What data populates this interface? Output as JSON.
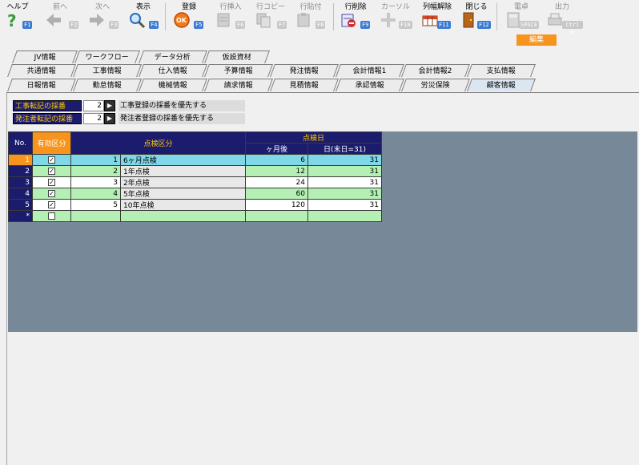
{
  "toolbar": {
    "buttons": [
      {
        "label": "ヘルプ",
        "key": "F1",
        "icon": "help-icon",
        "enabled": true
      },
      {
        "label": "前へ",
        "key": "F2",
        "icon": "arrow-left-icon",
        "enabled": false
      },
      {
        "label": "次へ",
        "key": "F3",
        "icon": "arrow-right-icon",
        "enabled": false
      },
      {
        "label": "表示",
        "key": "F4",
        "icon": "magnifier-icon",
        "enabled": true
      },
      {
        "label": "登録",
        "key": "F5",
        "icon": "ok-icon",
        "enabled": true
      },
      {
        "label": "行挿入",
        "key": "F6",
        "icon": "row-insert-icon",
        "enabled": false
      },
      {
        "label": "行コピー",
        "key": "F7",
        "icon": "row-copy-icon",
        "enabled": false
      },
      {
        "label": "行貼付",
        "key": "F8",
        "icon": "row-paste-icon",
        "enabled": false
      },
      {
        "label": "行削除",
        "key": "F9",
        "icon": "row-delete-icon",
        "enabled": true
      },
      {
        "label": "カーソル",
        "key": "F10",
        "icon": "cursor-icon",
        "enabled": false
      },
      {
        "label": "列幅解除",
        "key": "F11",
        "icon": "column-width-icon",
        "enabled": true
      },
      {
        "label": "閉じる",
        "key": "F12",
        "icon": "close-door-icon",
        "enabled": true
      },
      {
        "label": "電卓",
        "key": "SPACE",
        "icon": "calculator-icon",
        "enabled": false
      },
      {
        "label": "出力",
        "key": "Ctrl P",
        "icon": "output-icon",
        "enabled": false
      }
    ],
    "mode_badge": "編集"
  },
  "tabs": {
    "row1": [
      "JV情報",
      "ワークフロー",
      "データ分析",
      "仮設資材"
    ],
    "row2": [
      "共通情報",
      "工事情報",
      "仕入情報",
      "予算情報",
      "発注情報",
      "会計情報1",
      "会計情報2",
      "支払情報"
    ],
    "row3": [
      "日報情報",
      "勤怠情報",
      "機械情報",
      "請求情報",
      "見積情報",
      "承認情報",
      "労災保険",
      "顧客情報"
    ],
    "active": "顧客情報"
  },
  "options": [
    {
      "label": "工事転記の採番",
      "value": "2",
      "description": "工事登録の採番を優先する"
    },
    {
      "label": "発注者転記の採番",
      "value": "2",
      "description": "発注者登録の採番を優先する"
    }
  ],
  "grid": {
    "headers": {
      "no": "No.",
      "active": "有効区分",
      "category": "点検区分",
      "inspection_date": "点検日",
      "months_after": "ヶ月後",
      "day": "日(末日=31)"
    },
    "rows": [
      {
        "no": "1",
        "active": "✓",
        "code": "1",
        "name": "6ヶ月点検",
        "months": "6",
        "day": "31"
      },
      {
        "no": "2",
        "active": "✓",
        "code": "2",
        "name": "1年点検",
        "months": "12",
        "day": "31"
      },
      {
        "no": "3",
        "active": "✓",
        "code": "3",
        "name": "2年点検",
        "months": "24",
        "day": "31"
      },
      {
        "no": "4",
        "active": "✓",
        "code": "4",
        "name": "5年点検",
        "months": "60",
        "day": "31"
      },
      {
        "no": "5",
        "active": "✓",
        "code": "5",
        "name": "10年点検",
        "months": "120",
        "day": "31"
      }
    ],
    "new_row_marker": "*"
  }
}
